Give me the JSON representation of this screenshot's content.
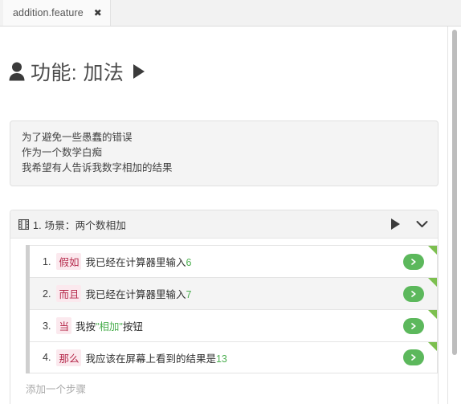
{
  "tab": {
    "label": "addition.feature",
    "close_glyph": "✖"
  },
  "feature": {
    "title": "功能: 加法",
    "person_icon": "person-icon",
    "play_icon": "play-icon",
    "description_lines": [
      "为了避免一些愚蠢的错误",
      "作为一个数学白痴",
      "我希望有人告诉我数字相加的结果"
    ]
  },
  "scenario": {
    "icon": "film-strip-icon",
    "title": "1. 场景：两个数相加",
    "play_icon": "play-icon",
    "collapse_icon": "chevron-down-icon",
    "steps": [
      {
        "num": "1.",
        "keyword": "假如",
        "text_before": "我已经在计算器里输入",
        "value": "6",
        "text_after": "",
        "run_label": "run-step-button"
      },
      {
        "num": "2.",
        "keyword": "而且",
        "text_before": "我已经在计算器里输入",
        "value": "7",
        "text_after": "",
        "run_label": "run-step-button"
      },
      {
        "num": "3.",
        "keyword": "当",
        "text_before": "我按",
        "value": "\"相加\"",
        "text_after": "按钮",
        "run_label": "run-step-button"
      },
      {
        "num": "4.",
        "keyword": "那么",
        "text_before": "我应该在屏幕上看到的结果是",
        "value": "13",
        "text_after": "",
        "run_label": "run-step-button"
      }
    ],
    "add_step_placeholder": "添加一个步骤"
  },
  "colors": {
    "keyword_text": "#b5294b",
    "keyword_bg": "#fbe9ee",
    "value_green": "#4caf50",
    "run_button": "#5cb85c",
    "corner_flag": "#7cbf4f",
    "tab_bar": "#f2f2f2"
  }
}
